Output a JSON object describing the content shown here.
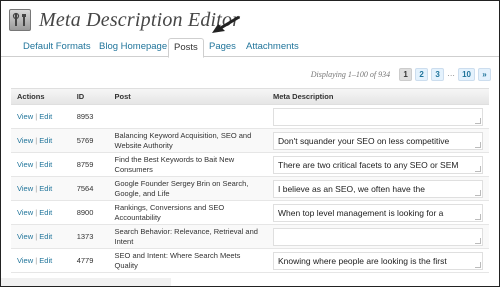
{
  "header": {
    "title": "Meta Description Editor"
  },
  "tabs": [
    {
      "label": "Default Formats"
    },
    {
      "label": "Blog Homepage"
    },
    {
      "label": "Posts"
    },
    {
      "label": "Pages"
    },
    {
      "label": "Attachments"
    }
  ],
  "pagination": {
    "displaying": "Displaying 1–100 of 934",
    "pages": [
      "1",
      "2",
      "3",
      "…",
      "10",
      "»"
    ]
  },
  "table": {
    "headers": [
      "Actions",
      "ID",
      "Post",
      "Meta Description"
    ],
    "view_label": "View",
    "edit_label": "Edit",
    "separator": "|",
    "rows": [
      {
        "id": "8953",
        "post": "",
        "description": ""
      },
      {
        "id": "5769",
        "post": "Balancing Keyword Acquisition, SEO and Website Authority",
        "description": "Don't squander your SEO on less competitive"
      },
      {
        "id": "8759",
        "post": "Find the Best Keywords to Bait New Consumers",
        "description": "There are two critical facets to any SEO or SEM"
      },
      {
        "id": "7564",
        "post": "Google Founder Sergey Brin on Search, Google, and Life",
        "description": "I believe as an SEO, we often have the"
      },
      {
        "id": "8900",
        "post": "Rankings, Conversions and SEO Accountability",
        "description": "When top level management is looking for a"
      },
      {
        "id": "1373",
        "post": "Search Behavior: Relevance, Retrieval and Intent",
        "description": ""
      },
      {
        "id": "4779",
        "post": "SEO and Intent: Where Search Meets Quality",
        "description": "Knowing where people are looking is the first"
      }
    ]
  }
}
